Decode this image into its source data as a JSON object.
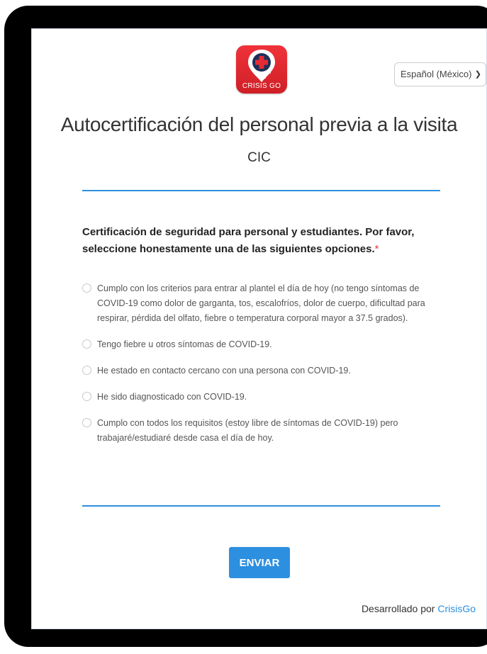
{
  "logo": {
    "text": "CRISIS GO",
    "icon": "crisisgo-logo-icon"
  },
  "language": {
    "selected": "Español (México)",
    "icon": "chevron-down-icon"
  },
  "form": {
    "title": "Autocertificación del personal previa a la visita",
    "subtitle": "CIC",
    "question": "Certificación de seguridad para personal y estudiantes. Por favor, seleccione honestamente una de las siguientes opciones.",
    "required_marker": "*",
    "options": [
      "Cumplo con los criterios para entrar al plantel el día de hoy (no tengo síntomas de COVID-19 como dolor de garganta, tos, escalofríos, dolor de cuerpo, dificultad para respirar, pérdida del olfato, fiebre o temperatura corporal mayor a 37.5 grados).",
      "Tengo fiebre u otros síntomas de COVID-19.",
      "He estado en contacto cercano con una persona con COVID-19.",
      "He sido diagnosticado con COVID-19.",
      "Cumplo con todos los requisitos (estoy libre de síntomas de COVID-19) pero trabajaré/estudiaré desde casa el día de hoy."
    ],
    "submit_label": "ENVIAR"
  },
  "footer": {
    "prefix": "Desarrollado por",
    "brand": "CrisisGo"
  },
  "colors": {
    "accent": "#2d8fe0",
    "logo_red": "#e62b33",
    "required": "#e53935"
  }
}
